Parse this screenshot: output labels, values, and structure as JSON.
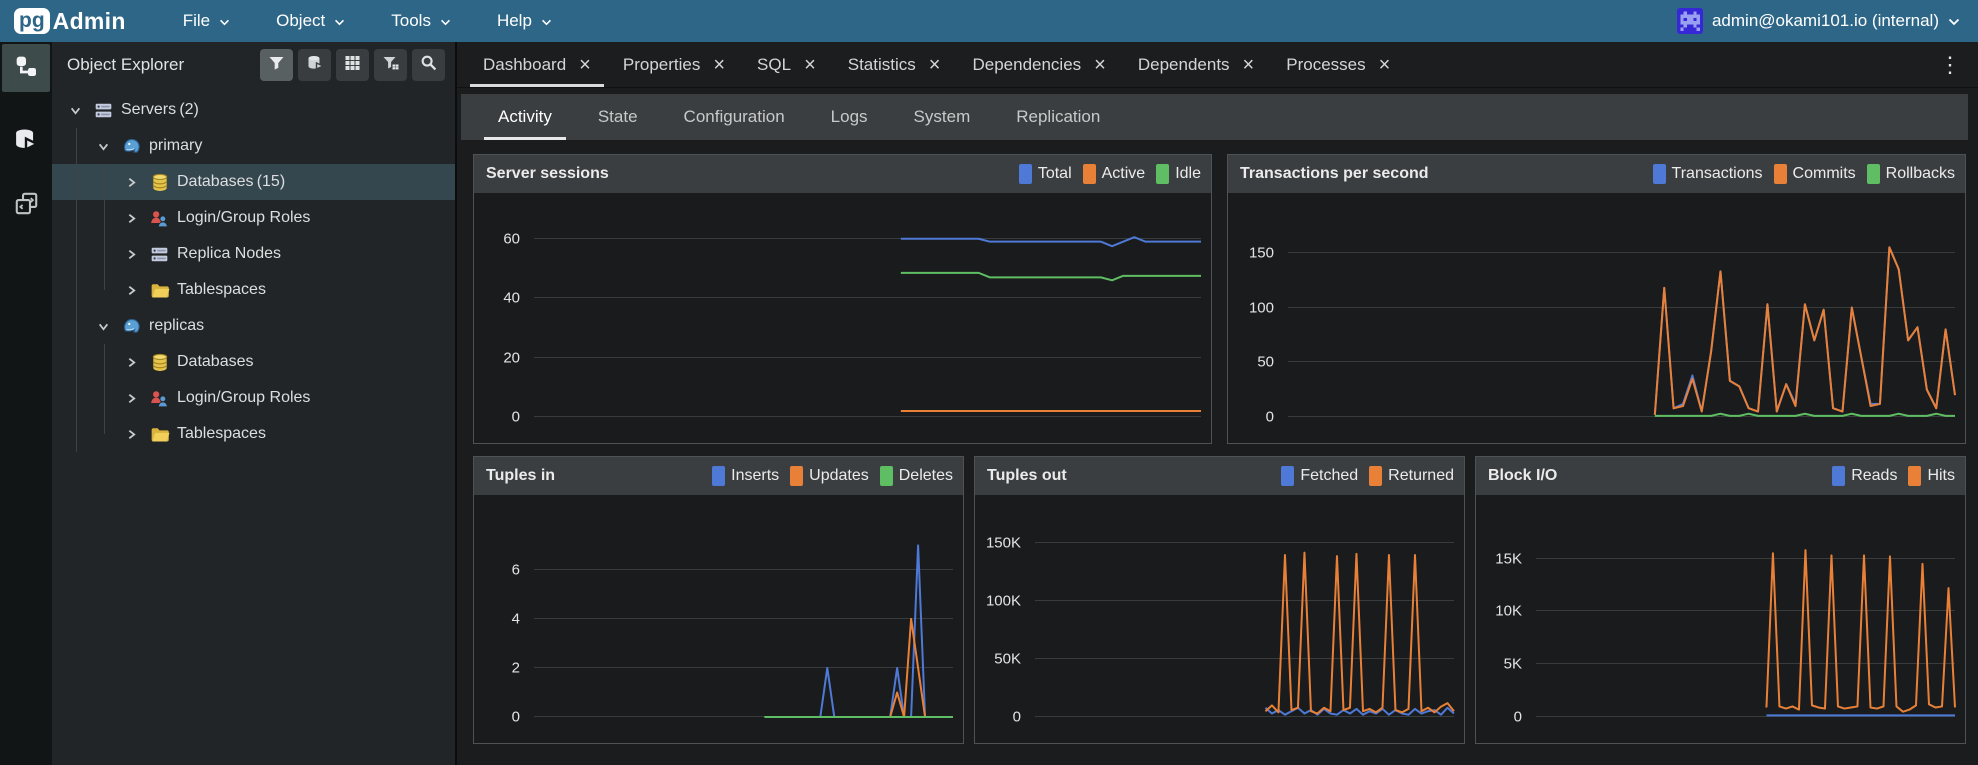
{
  "colors": {
    "topbar": "#2e6687",
    "selection": "#35474e",
    "blue": "#4e79d6",
    "orange": "#e98038",
    "green": "#5fbe63"
  },
  "menubar": {
    "logo_pg": "pg",
    "logo_admin": "Admin",
    "items": [
      {
        "label": "File"
      },
      {
        "label": "Object"
      },
      {
        "label": "Tools"
      },
      {
        "label": "Help"
      }
    ],
    "user": {
      "label": "admin@okami101.io (internal)"
    }
  },
  "activity_bar": {
    "items": [
      {
        "icon": "object-explorer-icon",
        "active": true
      },
      {
        "icon": "query-tool-icon",
        "active": false
      },
      {
        "icon": "layout-switch-icon",
        "active": false
      }
    ]
  },
  "object_explorer": {
    "title": "Object Explorer",
    "toolbar": [
      {
        "icon": "filter-icon",
        "active": true
      },
      {
        "icon": "database-arrow-icon",
        "active": false
      },
      {
        "icon": "grid-icon",
        "active": false
      },
      {
        "icon": "filter-table-icon",
        "active": false
      },
      {
        "icon": "search-icon",
        "active": false
      }
    ],
    "tree": [
      {
        "label": "Servers",
        "count": "(2)",
        "icon": "server-stack",
        "level": 0,
        "state": "expanded",
        "selected": false
      },
      {
        "label": "primary",
        "count": "",
        "icon": "postgres",
        "level": 1,
        "state": "expanded",
        "selected": false
      },
      {
        "label": "Databases",
        "count": "(15)",
        "icon": "database",
        "level": 2,
        "state": "collapsed",
        "selected": true
      },
      {
        "label": "Login/Group Roles",
        "count": "",
        "icon": "roles",
        "level": 2,
        "state": "collapsed",
        "selected": false
      },
      {
        "label": "Replica Nodes",
        "count": "",
        "icon": "server-stack",
        "level": 2,
        "state": "collapsed",
        "selected": false
      },
      {
        "label": "Tablespaces",
        "count": "",
        "icon": "folder",
        "level": 2,
        "state": "collapsed",
        "selected": false
      },
      {
        "label": "replicas",
        "count": "",
        "icon": "postgres",
        "level": 1,
        "state": "expanded",
        "selected": false
      },
      {
        "label": "Databases",
        "count": "",
        "icon": "database",
        "level": 2,
        "state": "collapsed",
        "selected": false
      },
      {
        "label": "Login/Group Roles",
        "count": "",
        "icon": "roles",
        "level": 2,
        "state": "collapsed",
        "selected": false
      },
      {
        "label": "Tablespaces",
        "count": "",
        "icon": "folder",
        "level": 2,
        "state": "collapsed",
        "selected": false
      }
    ]
  },
  "tabs": {
    "items": [
      {
        "label": "Dashboard",
        "active": true
      },
      {
        "label": "Properties",
        "active": false
      },
      {
        "label": "SQL",
        "active": false
      },
      {
        "label": "Statistics",
        "active": false
      },
      {
        "label": "Dependencies",
        "active": false
      },
      {
        "label": "Dependents",
        "active": false
      },
      {
        "label": "Processes",
        "active": false
      }
    ],
    "overflow_icon": "kebab-menu-icon",
    "close_glyph": "×",
    "kebab_glyph": "⋮"
  },
  "subtabs": {
    "items": [
      {
        "label": "Activity",
        "active": true
      },
      {
        "label": "State",
        "active": false
      },
      {
        "label": "Configuration",
        "active": false
      },
      {
        "label": "Logs",
        "active": false
      },
      {
        "label": "System",
        "active": false
      },
      {
        "label": "Replication",
        "active": false
      }
    ]
  },
  "chart_data": [
    {
      "type": "line",
      "title": "Server sessions",
      "ylim": [
        0,
        70
      ],
      "yticks": [
        {
          "v": 0,
          "label": "0"
        },
        {
          "v": 20,
          "label": "20"
        },
        {
          "v": 40,
          "label": "40"
        },
        {
          "v": 60,
          "label": "60"
        }
      ],
      "x_start_frac": 0.55,
      "grid": true,
      "legend_position": "header-right",
      "series": [
        {
          "name": "Total",
          "color": "blue",
          "values": [
            60,
            60,
            60,
            60,
            60,
            60,
            60,
            60,
            59,
            59,
            59,
            59,
            59,
            59,
            59,
            59,
            59,
            59,
            59,
            57.5,
            59,
            60.5,
            59,
            59,
            59,
            59,
            59,
            59
          ]
        },
        {
          "name": "Active",
          "color": "orange",
          "values": [
            2,
            2,
            2,
            2,
            2,
            2,
            2,
            2,
            2,
            2,
            2,
            2,
            2,
            2,
            2,
            2,
            2,
            2,
            2,
            2,
            2,
            2,
            2,
            2,
            2,
            2,
            2,
            2
          ]
        },
        {
          "name": "Idle",
          "color": "green",
          "values": [
            48.5,
            48.5,
            48.5,
            48.5,
            48.5,
            48.5,
            48.5,
            48.5,
            47,
            47,
            47,
            47,
            47,
            47,
            47,
            47,
            47,
            47,
            47,
            46,
            47.5,
            47.5,
            47.5,
            47.5,
            47.5,
            47.5,
            47.5,
            47.5
          ]
        }
      ]
    },
    {
      "type": "line",
      "title": "Transactions per second",
      "ylim": [
        0,
        190
      ],
      "yticks": [
        {
          "v": 0,
          "label": "0"
        },
        {
          "v": 50,
          "label": "50"
        },
        {
          "v": 100,
          "label": "100"
        },
        {
          "v": 150,
          "label": "150"
        }
      ],
      "x_start_frac": 0.55,
      "grid": true,
      "legend_position": "header-right",
      "series": [
        {
          "name": "Transactions",
          "color": "blue",
          "values": [
            2,
            118,
            8,
            12,
            38,
            5,
            60,
            133,
            33,
            28,
            8,
            5,
            103,
            5,
            30,
            12,
            103,
            70,
            98,
            8,
            5,
            100,
            55,
            12,
            12,
            155,
            135,
            70,
            82,
            25,
            8,
            80,
            20
          ]
        },
        {
          "name": "Commits",
          "color": "orange",
          "values": [
            2,
            118,
            8,
            10,
            35,
            5,
            60,
            133,
            33,
            28,
            8,
            5,
            103,
            5,
            30,
            10,
            103,
            70,
            98,
            8,
            5,
            100,
            55,
            10,
            12,
            155,
            135,
            70,
            82,
            25,
            8,
            80,
            20
          ]
        },
        {
          "name": "Rollbacks",
          "color": "green",
          "values": [
            1,
            1,
            1,
            1,
            1,
            1,
            1,
            3,
            1,
            1,
            3,
            1,
            1,
            1,
            1,
            1,
            3,
            1,
            1,
            1,
            1,
            3,
            1,
            1,
            1,
            1,
            3,
            1,
            1,
            1,
            3,
            1,
            1
          ]
        }
      ]
    },
    {
      "type": "line",
      "title": "Tuples in",
      "ylim": [
        0,
        8.4
      ],
      "yticks": [
        {
          "v": 0,
          "label": "0"
        },
        {
          "v": 2,
          "label": "2"
        },
        {
          "v": 4,
          "label": "4"
        },
        {
          "v": 6,
          "label": "6"
        }
      ],
      "x_start_frac": 0.55,
      "grid": true,
      "legend_position": "header-right",
      "series": [
        {
          "name": "Inserts",
          "color": "blue",
          "values": [
            0,
            0,
            0,
            0,
            0,
            0,
            0,
            0,
            0,
            2,
            0,
            0,
            0,
            0,
            0,
            0,
            0,
            0,
            0,
            2,
            0,
            0,
            7,
            0,
            0,
            0,
            0,
            0
          ]
        },
        {
          "name": "Updates",
          "color": "orange",
          "values": [
            0,
            0,
            0,
            0,
            0,
            0,
            0,
            0,
            0,
            0,
            0,
            0,
            0,
            0,
            0,
            0,
            0,
            0,
            0,
            1,
            0,
            4,
            2,
            0,
            0,
            0,
            0,
            0
          ]
        },
        {
          "name": "Deletes",
          "color": "green",
          "values": [
            0,
            0,
            0,
            0,
            0,
            0,
            0,
            0,
            0,
            0,
            0,
            0,
            0,
            0,
            0,
            0,
            0,
            0,
            0,
            0,
            0,
            0,
            0,
            0,
            0,
            0,
            0,
            0
          ]
        }
      ]
    },
    {
      "type": "line",
      "title": "Tuples out",
      "unit": "K",
      "ylim": [
        0,
        178
      ],
      "yticks": [
        {
          "v": 0,
          "label": "0"
        },
        {
          "v": 50,
          "label": "50K"
        },
        {
          "v": 100,
          "label": "100K"
        },
        {
          "v": 150,
          "label": "150K"
        }
      ],
      "x_start_frac": 0.55,
      "grid": true,
      "legend_position": "header-right",
      "series": [
        {
          "name": "Fetched",
          "color": "blue",
          "values": [
            8,
            3,
            6,
            2,
            5,
            8,
            3,
            6,
            2,
            7,
            3,
            2,
            6,
            3,
            7,
            2,
            5,
            3,
            7,
            2,
            6,
            3,
            2,
            7,
            3,
            5,
            6,
            2,
            8,
            3
          ]
        },
        {
          "name": "Returned",
          "color": "orange",
          "values": [
            5,
            10,
            4,
            140,
            6,
            8,
            142,
            5,
            3,
            8,
            5,
            139,
            6,
            8,
            141,
            5,
            7,
            4,
            8,
            140,
            6,
            4,
            7,
            140,
            5,
            8,
            4,
            9,
            12,
            5
          ]
        }
      ]
    },
    {
      "type": "line",
      "title": "Block I/O",
      "unit": "K",
      "ylim": [
        0,
        19.5
      ],
      "yticks": [
        {
          "v": 0,
          "label": "0"
        },
        {
          "v": 5,
          "label": "5K"
        },
        {
          "v": 10,
          "label": "10K"
        },
        {
          "v": 15,
          "label": "15K"
        }
      ],
      "x_start_frac": 0.55,
      "grid": true,
      "legend_position": "header-right",
      "series": [
        {
          "name": "Reads",
          "color": "blue",
          "values": [
            0.15,
            0.15,
            0.15,
            0.15,
            0.15,
            0.15,
            0.15,
            0.15,
            0.15,
            0.15,
            0.15,
            0.15,
            0.15,
            0.15,
            0.15,
            0.15,
            0.15,
            0.15,
            0.15,
            0.15,
            0.15,
            0.15,
            0.15,
            0.15,
            0.15,
            0.15,
            0.15,
            0.15,
            0.15,
            0.15
          ]
        },
        {
          "name": "Hits",
          "color": "orange",
          "values": [
            0.9,
            15.5,
            1,
            0.8,
            1,
            0.7,
            15.8,
            1.1,
            0.9,
            0.8,
            15.3,
            1,
            0.8,
            0.9,
            1,
            15.3,
            0.9,
            0.8,
            1,
            15.2,
            1,
            0.5,
            0.7,
            1.1,
            14.5,
            1.2,
            0.9,
            1,
            12.2,
            0.9
          ]
        }
      ]
    }
  ]
}
